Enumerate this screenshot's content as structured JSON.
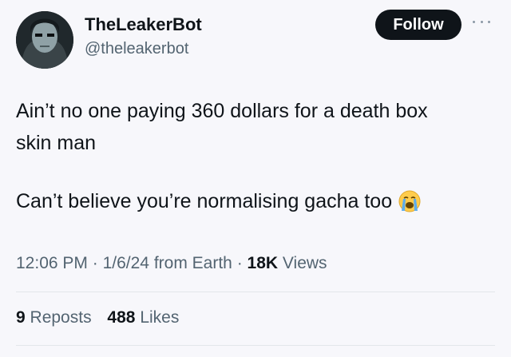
{
  "author": {
    "display_name": "TheLeakerBot",
    "handle": "@theleakerbot"
  },
  "actions": {
    "follow_label": "Follow"
  },
  "tweet": {
    "lines": [
      "Ain’t no one paying 360 dollars for a death box",
      "skin man",
      "Can’t believe you’re normalising gacha too"
    ],
    "emoji": "loudly-crying-face"
  },
  "meta": {
    "time": "12:06 PM",
    "date": "1/6/24",
    "source": "from Earth",
    "views_count": "18K",
    "views_label": "Views",
    "separator": "·"
  },
  "stats": {
    "reposts_count": "9",
    "reposts_label": "Reposts",
    "likes_count": "488",
    "likes_label": "Likes"
  },
  "colors": {
    "text": "#0f1419",
    "secondary": "#536471",
    "button": "#0f1419",
    "background": "#f7f7fb"
  }
}
